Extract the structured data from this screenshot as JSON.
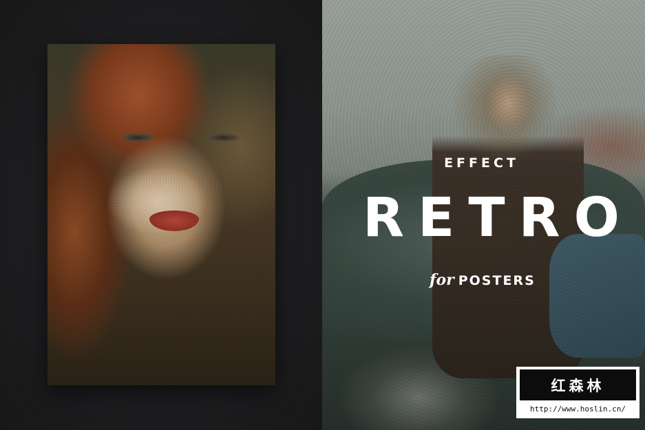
{
  "poster": {
    "effect_label": "EFFECT",
    "retro_label": "RETRO",
    "for_label": "for",
    "posters_label": "POSTERS"
  },
  "watermark": {
    "brand": "红森林",
    "url": "http://www.hoslin.cn/"
  },
  "colors": {
    "background": "#1d1d1f",
    "text": "#ffffff",
    "watermark_bg": "#0c0c0c"
  }
}
